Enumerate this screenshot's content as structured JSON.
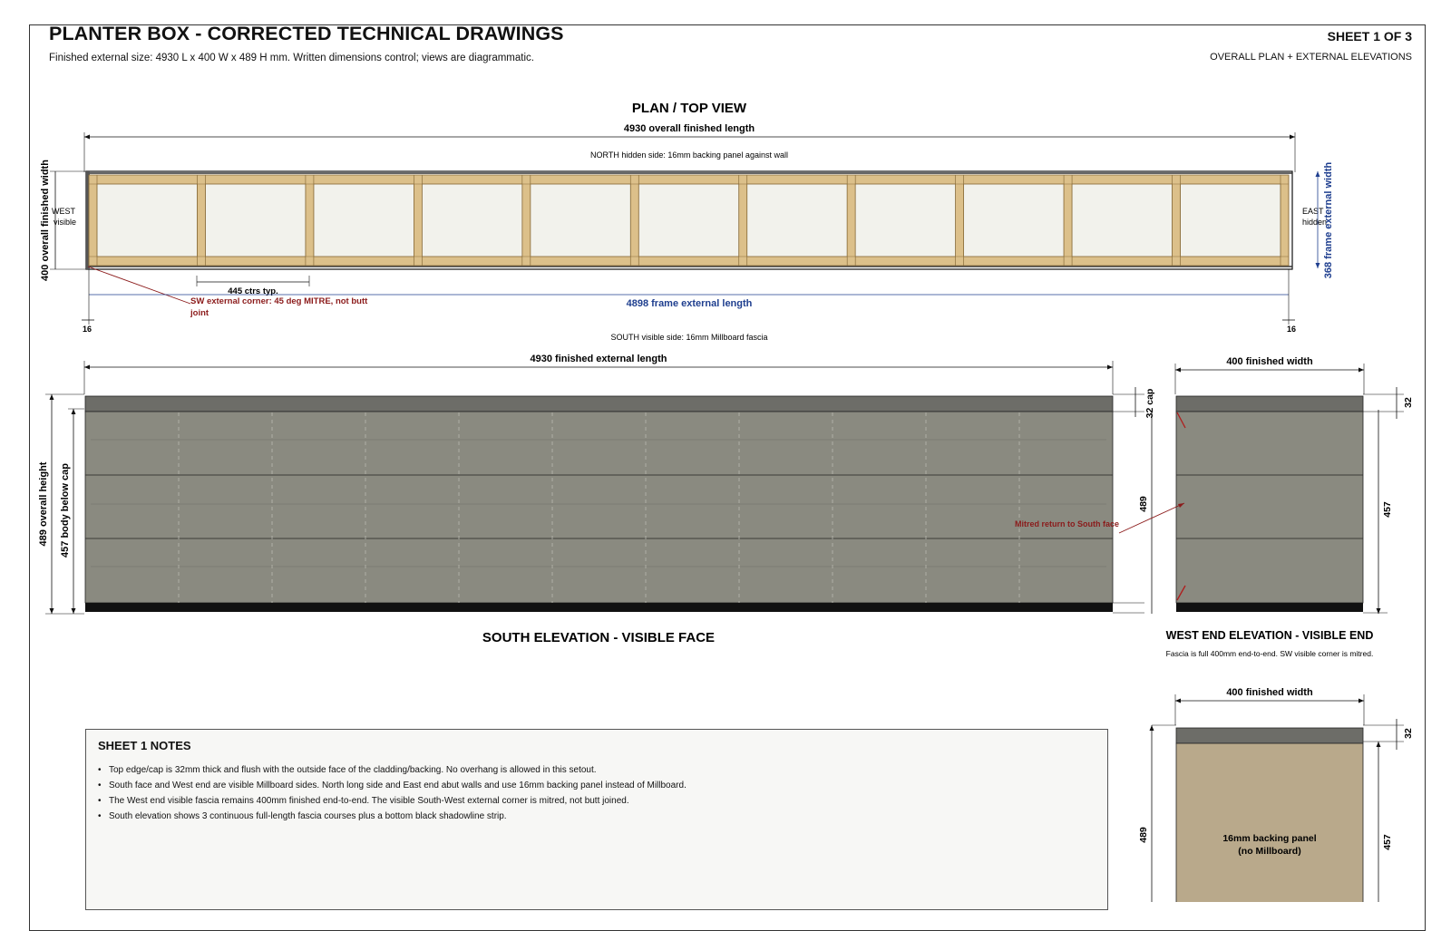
{
  "header": {
    "title": "PLANTER BOX - CORRECTED TECHNICAL DRAWINGS",
    "subtitle": "Finished external size: 4930 L x 400 W x 489 H mm. Written dimensions control; views are diagrammatic.",
    "sheet": "SHEET 1 OF 3",
    "sheet_subtitle": "OVERALL PLAN + EXTERNAL ELEVATIONS"
  },
  "plan": {
    "title": "PLAN / TOP VIEW",
    "overall_length": "4930 overall finished length",
    "north_note": "NORTH hidden side: 16mm backing panel against wall",
    "overall_width": "400 overall finished width",
    "west_label_1": "WEST",
    "west_label_2": "visible",
    "east_label_1": "EAST",
    "east_label_2": "hidden",
    "frame_width": "368 frame external width",
    "centres": "445 ctrs typ.",
    "corner_note_1": "SW external corner: 45 deg MITRE, not butt",
    "corner_note_2": "joint",
    "frame_length": "4898 frame external length",
    "left_offset": "16",
    "right_offset": "16",
    "south_note": "SOUTH visible side: 16mm Millboard fascia",
    "bay_count": 11
  },
  "south_elevation": {
    "title": "SOUTH ELEVATION - VISIBLE FACE",
    "length": "4930 finished external length",
    "overall_height": "489 overall height",
    "body_height": "457 body below cap",
    "cap": "32 cap",
    "height_right": "489",
    "mitre_note": "Mitred return to South face"
  },
  "west_elevation": {
    "title": "WEST END ELEVATION - VISIBLE END",
    "subtitle": "Fascia is full 400mm end-to-end. SW visible corner is mitred.",
    "width": "400 finished width",
    "cap": "32",
    "body": "457"
  },
  "east_elevation": {
    "width": "400 finished width",
    "cap": "32",
    "height": "489",
    "body": "457",
    "panel_label_1": "16mm backing panel",
    "panel_label_2": "(no Millboard)"
  },
  "notes": {
    "title": "SHEET 1 NOTES",
    "items": [
      "Top edge/cap is 32mm thick and flush with the outside face of the cladding/backing. No overhang is allowed in this setout.",
      "South face and West end are visible Millboard sides. North long side and East end abut walls and use 16mm backing panel instead of Millboard.",
      "The West end visible fascia remains 400mm finished end-to-end. The visible South-West external corner is mitred, not butt joined.",
      "South elevation shows 3 continuous full-length fascia courses plus a bottom black shadowline strip."
    ]
  },
  "colors": {
    "timber": "#dcc08a",
    "timber_stroke": "#8a6d3b",
    "infill": "#f2f2ec",
    "fascia": "#8a8a80",
    "cap": "#6d6d68",
    "shadowline": "#111111",
    "backing": "#b9a98b",
    "dim_blue": "#1f3f8f",
    "note_red": "#8b1a1a"
  }
}
